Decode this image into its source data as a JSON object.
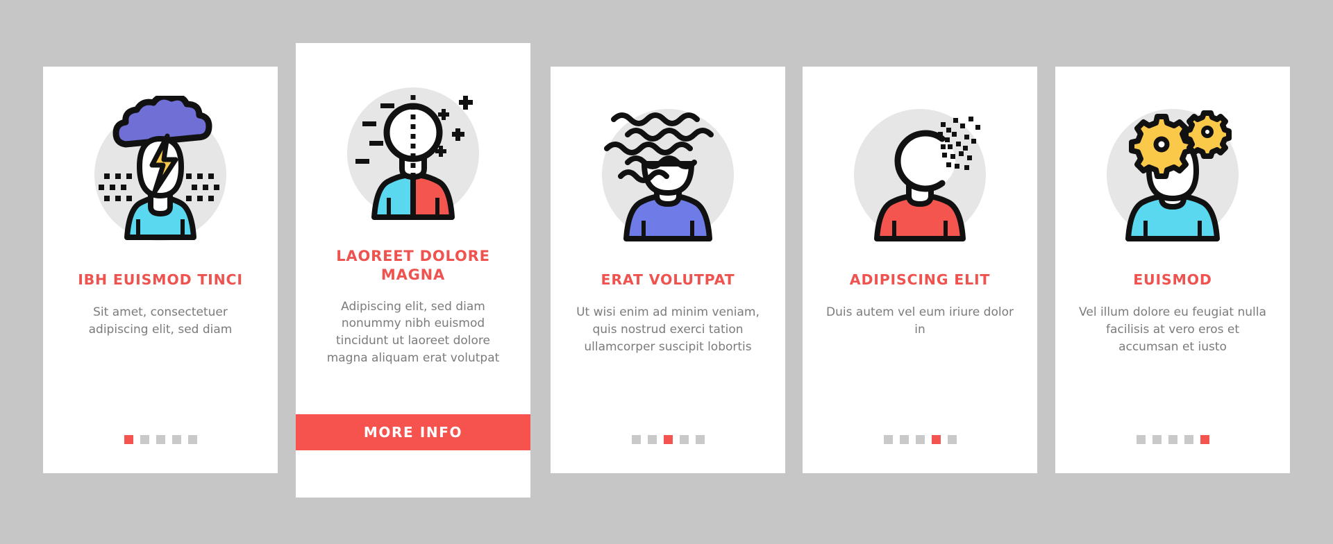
{
  "page": {
    "background_color": "#c6c6c6",
    "accent_color": "#ef5350",
    "cta_color": "#f6534f",
    "dot_inactive_color": "#c9c9c9",
    "dot_active_color": "#f4544f",
    "card_background": "#ffffff",
    "illustration_circle_color": "#e6e6e6"
  },
  "cards": [
    {
      "id": "card-1",
      "featured": false,
      "icon_name": "storm-cloud-head-icon",
      "title": "IBH EUISMOD TINCI",
      "description": "Sit amet, consectetuer adipiscing elit, sed diam",
      "shirt_color": "#5ad8f0",
      "accent_shape_color": "#6f6fd6",
      "bolt_color": "#fbc94a",
      "pagination": {
        "total": 5,
        "active_index": 1
      }
    },
    {
      "id": "card-2",
      "featured": true,
      "icon_name": "split-personality-icon",
      "title": "LAOREET DOLORE MAGNA",
      "description": "Adipiscing elit, sed diam nonummy nibh euismod tincidunt ut laoreet dolore magna aliquam erat volutpat",
      "shirt_color_left": "#5ad8f0",
      "shirt_color_right": "#f4554f",
      "cta_label": "MORE INFO",
      "pagination": {
        "total": 0,
        "active_index": 0
      }
    },
    {
      "id": "card-3",
      "featured": false,
      "icon_name": "wavy-dissolving-head-icon",
      "title": "ERAT VOLUTPAT",
      "description": "Ut wisi enim ad minim veniam, quis nostrud exerci tation ullamcorper suscipit lobortis",
      "shirt_color": "#6f7ce8",
      "pagination": {
        "total": 5,
        "active_index": 3
      }
    },
    {
      "id": "card-4",
      "featured": false,
      "icon_name": "pixelated-head-icon",
      "title": "ADIPISCING ELIT",
      "description": "Duis autem vel eum iriure dolor in",
      "shirt_color": "#f4554f",
      "pagination": {
        "total": 5,
        "active_index": 4
      }
    },
    {
      "id": "card-5",
      "featured": false,
      "icon_name": "gears-head-icon",
      "title": "EUISMOD",
      "description": "Vel illum dolore eu feugiat nulla facilisis at vero eros et accumsan et iusto",
      "shirt_color": "#5ad8f0",
      "gear_color": "#fbc94a",
      "pagination": {
        "total": 5,
        "active_index": 5
      }
    }
  ]
}
